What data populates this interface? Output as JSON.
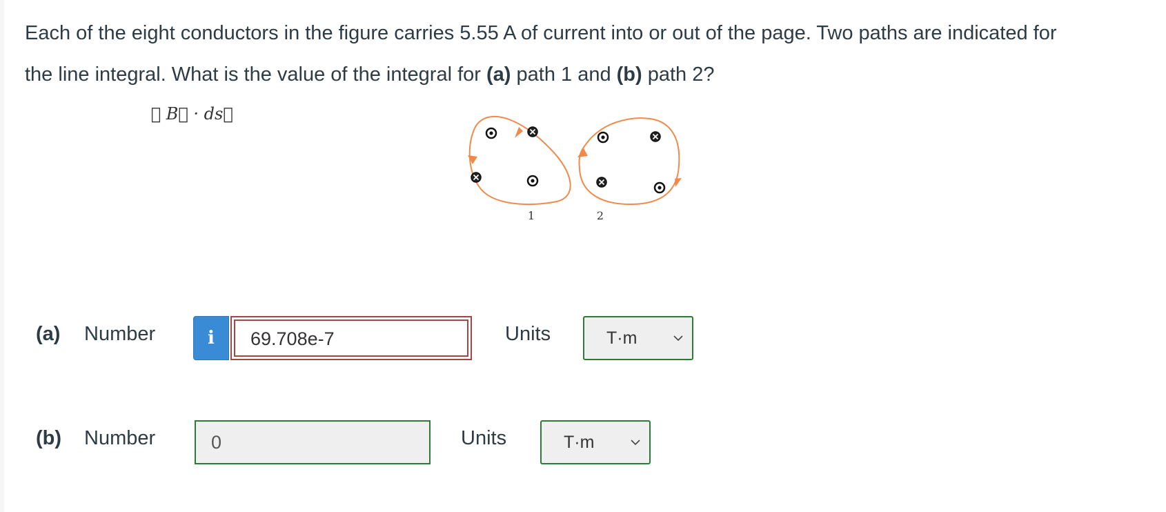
{
  "question": {
    "line1": "Each of the eight conductors in the figure carries 5.55 A of current into or out of the page. Two paths are indicated for",
    "line2_pre": "the line integral",
    "line2_post": ". What is the value of the integral for ",
    "part_a_ref": "(a)",
    "mid": " path 1 and ",
    "part_b_ref": "(b)",
    "end": " path 2?",
    "integral": "∮ B⃗ · ds⃗"
  },
  "figure": {
    "path1_label": "1",
    "path2_label": "2",
    "path_color": "#f08a4b",
    "conductor_symbols": [
      "out",
      "in",
      "in",
      "out",
      "out",
      "in",
      "in",
      "out"
    ]
  },
  "answers": {
    "a": {
      "part": "(a)",
      "label": "Number",
      "info_icon": "i",
      "value": "69.708e-7",
      "units_label": "Units",
      "unit": "T·m"
    },
    "b": {
      "part": "(b)",
      "label": "Number",
      "value": "0",
      "units_label": "Units",
      "unit": "T·m"
    }
  },
  "colors": {
    "info_button": "#3a8bd6",
    "invalid_border": "#a14545",
    "valid_border": "#2c7a35"
  }
}
